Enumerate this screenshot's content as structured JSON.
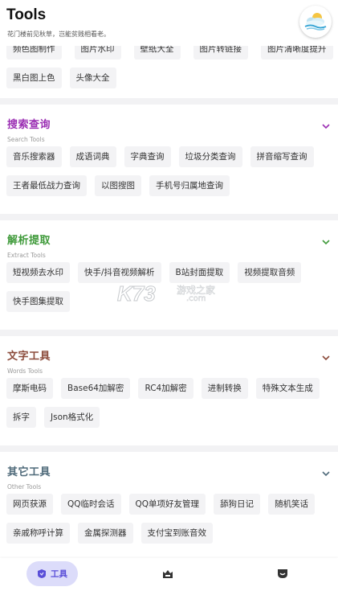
{
  "header": {
    "title": "Tools",
    "subtitle": "花门楼前见秋草，岂能贫贱相看老。"
  },
  "top_partial": {
    "row1": [
      "频色图制作",
      "图片水印",
      "壁纸大全",
      "图片转链接",
      "图片清晰度提升"
    ],
    "row2": [
      "黑白图上色",
      "头像大全"
    ]
  },
  "sections": [
    {
      "title": "搜索查询",
      "subtitle": "Search Tools",
      "color": "#9b2fb3",
      "items": [
        "音乐搜索器",
        "成语词典",
        "字典查询",
        "垃圾分类查询",
        "拼音缩写查询",
        "王者最低战力查询",
        "以图搜图",
        "手机号归属地查询"
      ]
    },
    {
      "title": "解析提取",
      "subtitle": "Extract Tools",
      "color": "#3f9a3a",
      "items": [
        "短视频去水印",
        "快手/抖音视频解析",
        "B站封面提取",
        "视频提取音频",
        "快手图集提取"
      ]
    },
    {
      "title": "文字工具",
      "subtitle": "Words Tools",
      "color": "#8b4a3a",
      "items": [
        "摩斯电码",
        "Base64加解密",
        "RC4加解密",
        "进制转换",
        "特殊文本生成",
        "拆字",
        "Json格式化"
      ]
    },
    {
      "title": "其它工具",
      "subtitle": "Other Tools",
      "color": "#4f6a7a",
      "items": [
        "网页获源",
        "QQ临时会话",
        "QQ单项好友管理",
        "舔狗日记",
        "随机笑话",
        "亲戚称呼计算",
        "金属探测器",
        "支付宝到账音效"
      ]
    }
  ],
  "bottom_nav": {
    "tools_label": "工具"
  },
  "watermark": {
    "brand": "K73",
    "text": "游戏之家",
    "url": ".com"
  },
  "colors": {
    "accent": "#5a4fd8",
    "nav_active_bg": "#dcdcfa"
  }
}
